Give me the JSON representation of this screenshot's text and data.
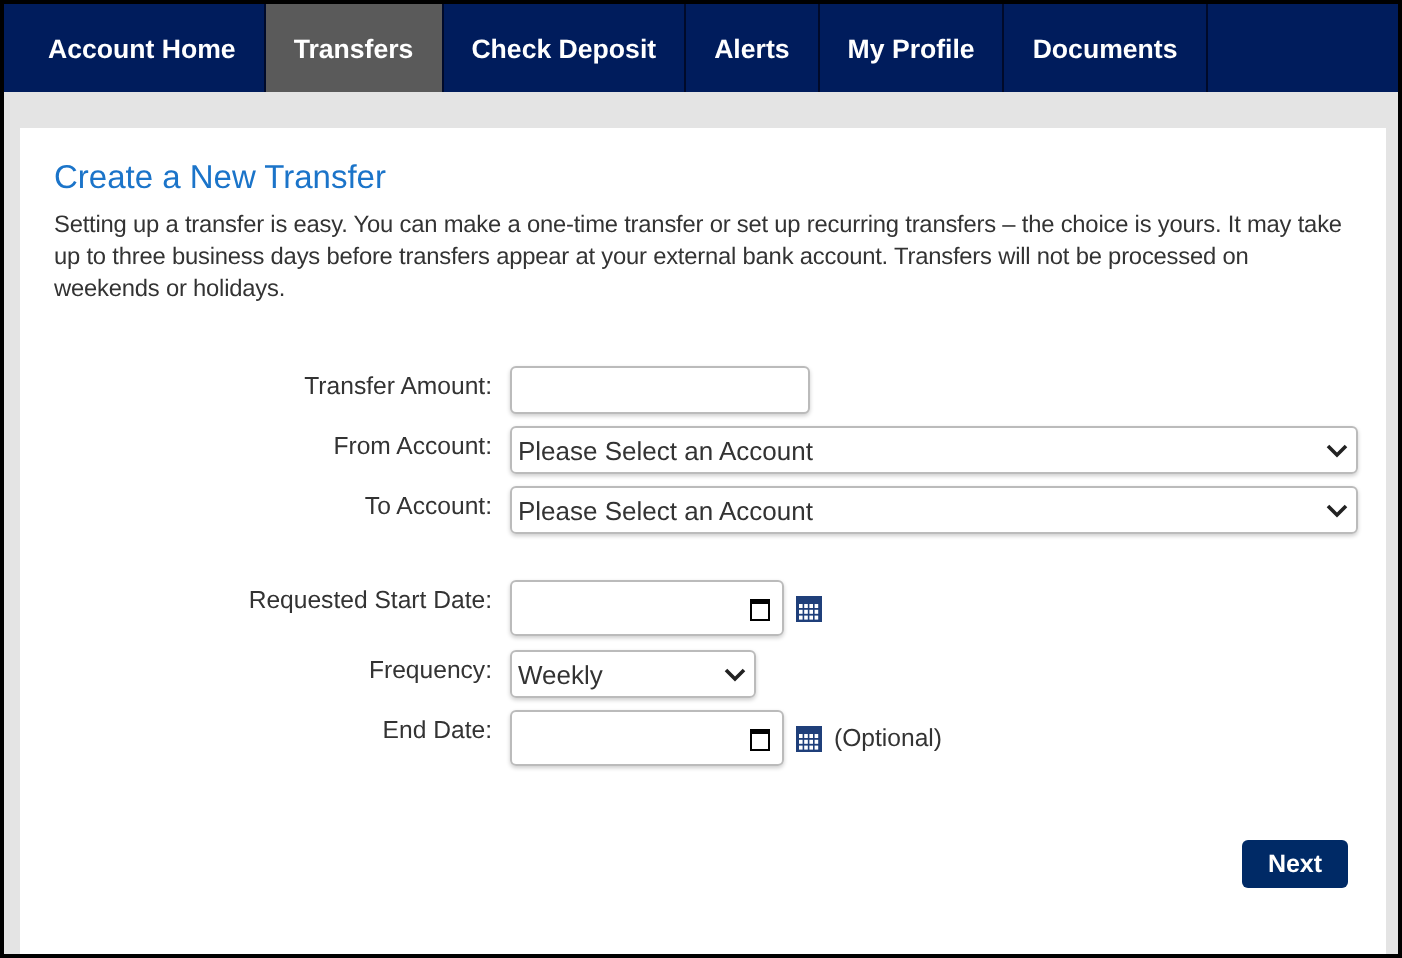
{
  "nav": {
    "tabs": [
      {
        "label": "Account Home",
        "selected": false
      },
      {
        "label": "Transfers",
        "selected": true
      },
      {
        "label": "Check Deposit",
        "selected": false
      },
      {
        "label": "Alerts",
        "selected": false
      },
      {
        "label": "My Profile",
        "selected": false
      },
      {
        "label": "Documents",
        "selected": false
      }
    ]
  },
  "form": {
    "title": "Create a New Transfer",
    "intro": "Setting up a transfer is easy. You can make a one-time transfer or set up recurring transfers – the choice is yours. It may take up to three business days before transfers appear at your external bank account. Transfers will not be processed on weekends or holidays.",
    "fields": [
      {
        "kind": "text",
        "label": "Transfer Amount:"
      },
      {
        "kind": "wide_select",
        "label": "From Account:",
        "value": "Please Select an Account"
      },
      {
        "kind": "wide_select",
        "label": "To Account:",
        "value": "Please Select an Account"
      },
      {
        "kind": "spacer"
      },
      {
        "kind": "date",
        "label": "Requested Start Date:"
      },
      {
        "kind": "select",
        "label": "Frequency:",
        "value": "Weekly"
      },
      {
        "kind": "date",
        "label": "End Date:",
        "note": "(Optional)"
      }
    ],
    "next_button": "Next"
  }
}
